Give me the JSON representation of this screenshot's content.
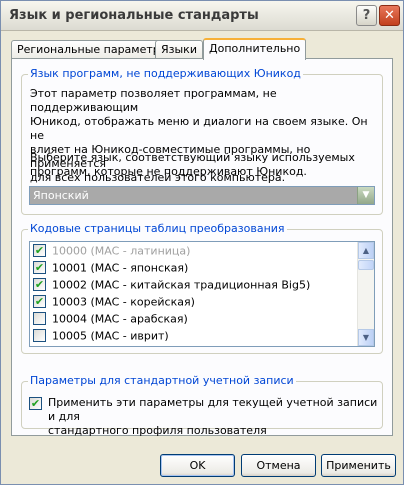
{
  "window": {
    "title": "Язык и региональные стандарты",
    "help_label": "?",
    "close_label": "✕"
  },
  "tabs": [
    {
      "label": "Региональные параметры",
      "active": false
    },
    {
      "label": "Языки",
      "active": false
    },
    {
      "label": "Дополнительно",
      "active": true
    }
  ],
  "unicode_group": {
    "title": "Язык программ, не поддерживающих Юникод",
    "description": [
      "Этот параметр позволяет программам, не поддерживающим",
      "Юникод, отображать меню и диалоги на своем языке. Он не",
      "влияет на Юникод-совместимые программы, но применяется",
      "для всех пользователей этого компьютера."
    ],
    "prompt": [
      "Выберите язык, соответствующий языку используемых",
      "программ, которые не поддерживают Юникод."
    ],
    "selected_language": "Японский"
  },
  "codepages_group": {
    "title": "Кодовые страницы таблиц преобразования",
    "items": [
      {
        "label": "10000 (MAC - латиница)",
        "checked": true,
        "disabled": true
      },
      {
        "label": "10001 (MAC - японская)",
        "checked": true,
        "disabled": false
      },
      {
        "label": "10002 (MAC - китайская традиционная Big5)",
        "checked": true,
        "disabled": false
      },
      {
        "label": "10003 (MAC - корейская)",
        "checked": true,
        "disabled": false
      },
      {
        "label": "10004 (MAC - арабская)",
        "checked": false,
        "disabled": false
      },
      {
        "label": "10005 (MAC - иврит)",
        "checked": false,
        "disabled": false
      }
    ]
  },
  "default_account_group": {
    "title": "Параметры для стандартной учетной записи",
    "checkbox_checked": true,
    "checkbox_label": [
      "Применить эти параметры для текущей учетной записи и для",
      "стандартного профиля пользователя"
    ]
  },
  "buttons": {
    "ok": "OK",
    "cancel": "Отмена",
    "apply": "Применить"
  },
  "glyphs": {
    "check": "✔",
    "dropdown": "▼",
    "scroll_up": "▲",
    "scroll_down": "▼"
  }
}
